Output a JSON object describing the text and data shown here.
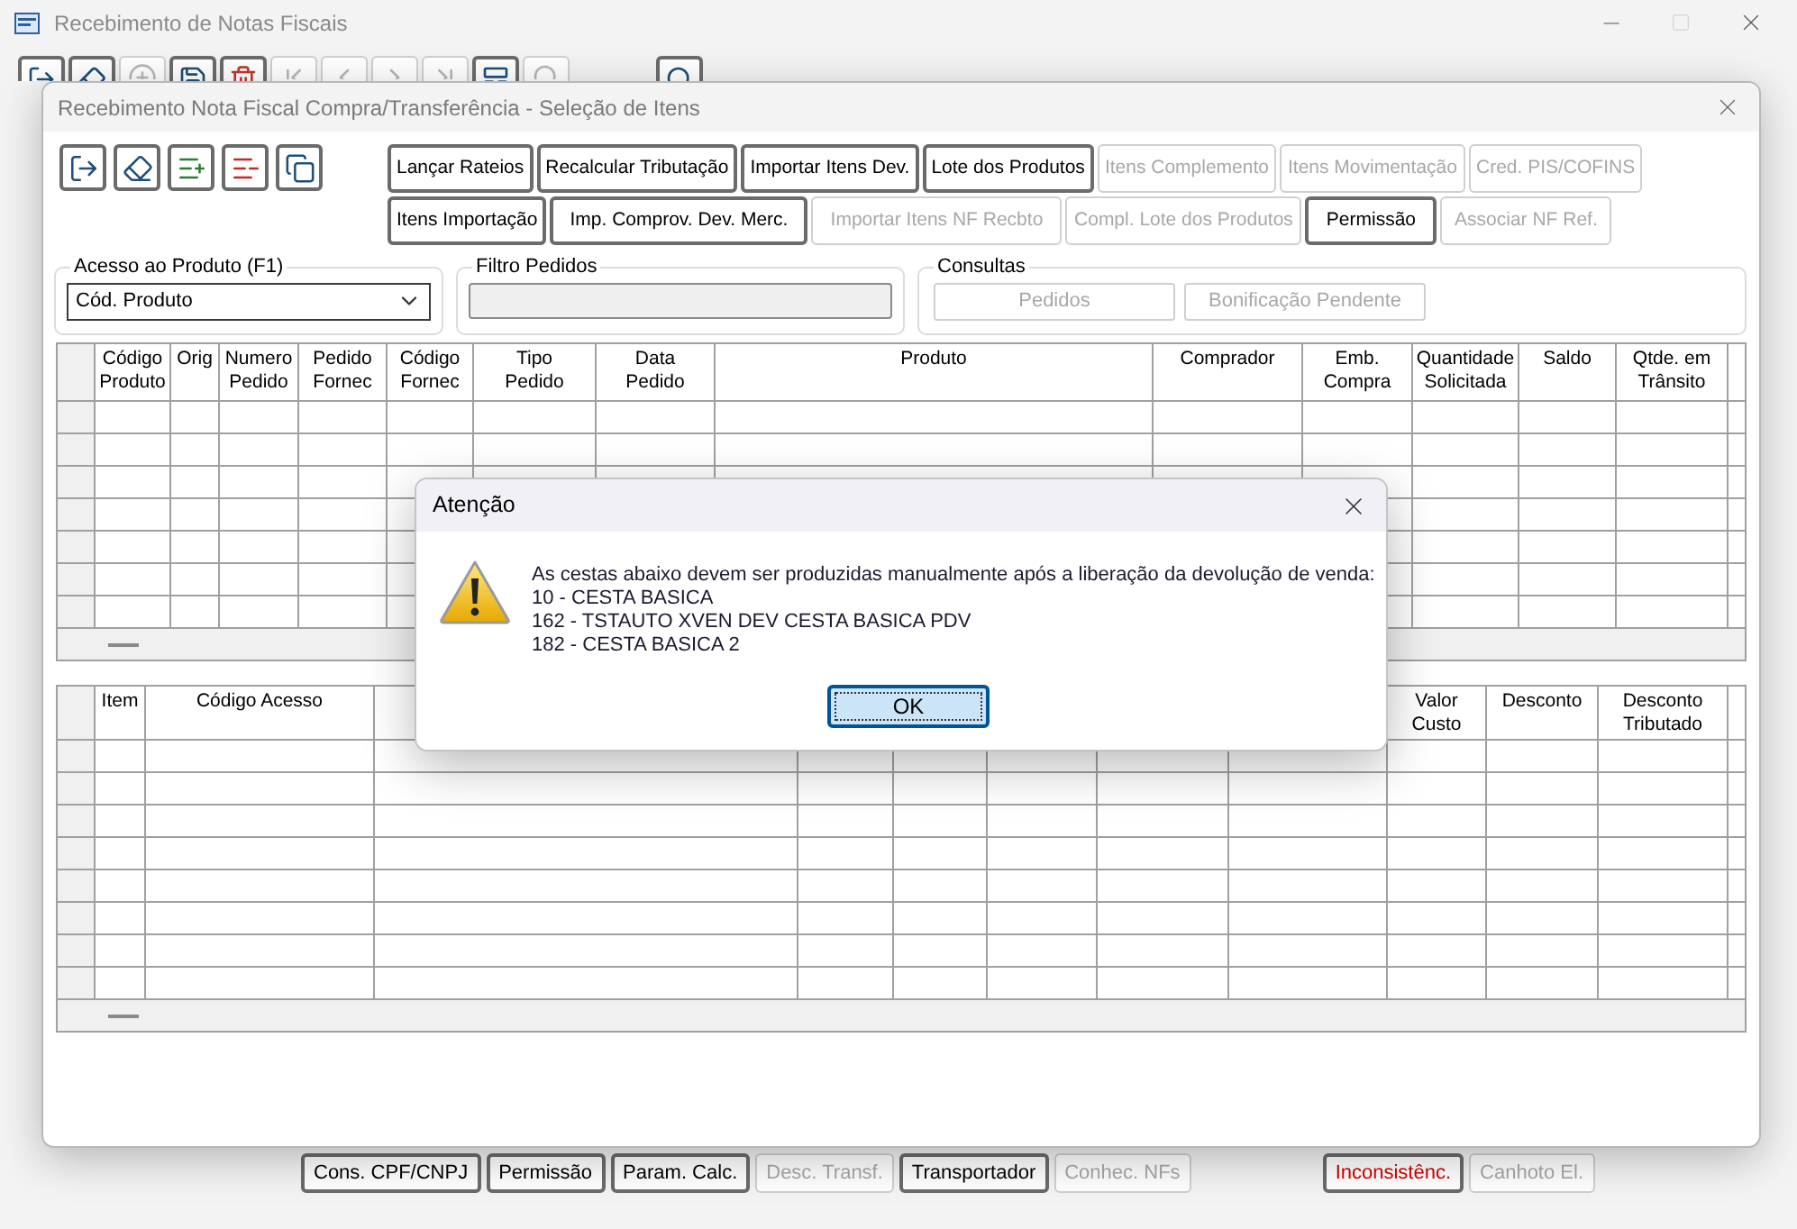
{
  "background_window": {
    "title": "Recebimento de Notas Fiscais",
    "toolbar": [
      {
        "kind": "exit",
        "disabled": false
      },
      {
        "kind": "eraser",
        "disabled": false
      },
      {
        "kind": "add",
        "disabled": true
      },
      {
        "kind": "save",
        "disabled": false
      },
      {
        "kind": "delete",
        "disabled": false
      },
      {
        "kind": "first",
        "disabled": true
      },
      {
        "kind": "previous",
        "disabled": true
      },
      {
        "kind": "next",
        "disabled": true
      },
      {
        "kind": "last",
        "disabled": true
      },
      {
        "kind": "grid",
        "disabled": false
      },
      {
        "kind": "search",
        "disabled": true
      },
      {
        "kind": "search",
        "disabled": false
      }
    ],
    "bottom_buttons": [
      {
        "label": "Cons. CPF/CNPJ",
        "disabled": false
      },
      {
        "label": "Permissão",
        "disabled": false
      },
      {
        "label": "Param. Calc.",
        "disabled": false
      },
      {
        "label": "Desc. Transf.",
        "disabled": true
      },
      {
        "label": "Transportador",
        "disabled": false
      },
      {
        "label": "Conhec. NFs",
        "disabled": true
      },
      {
        "label": "Inconsistênc.",
        "disabled": false,
        "color": "#d40000"
      },
      {
        "label": "Canhoto El.",
        "disabled": true
      }
    ]
  },
  "window": {
    "title": "Recebimento Nota Fiscal Compra/Transferência - Seleção de Itens",
    "icon_buttons": [
      {
        "kind": "exit"
      },
      {
        "kind": "eraser"
      },
      {
        "kind": "list-add"
      },
      {
        "kind": "list-remove"
      },
      {
        "kind": "copy"
      }
    ],
    "button_rows": [
      [
        {
          "label": "Lançar Rateios",
          "disabled": false
        },
        {
          "label": "Recalcular Tributação",
          "disabled": false
        },
        {
          "label": "Importar Itens Dev.",
          "disabled": false
        },
        {
          "label": "Lote dos Produtos",
          "disabled": false
        },
        {
          "label": "Itens Complemento",
          "disabled": true
        },
        {
          "label": "Itens Movimentação",
          "disabled": true
        },
        {
          "label": "Cred. PIS/COFINS",
          "disabled": true
        }
      ],
      [
        {
          "label": "Itens Importação",
          "disabled": false
        },
        {
          "label": "Imp. Comprov. Dev. Merc.",
          "disabled": false
        },
        {
          "label": "Importar Itens NF Recbto",
          "disabled": true
        },
        {
          "label": "Compl. Lote dos Produtos",
          "disabled": true
        },
        {
          "label": "Permissão",
          "disabled": false
        },
        {
          "label": "Associar NF Ref.",
          "disabled": true
        }
      ]
    ],
    "product_access": {
      "title": "Acesso ao Produto (F1)",
      "value": "Cód. Produto"
    },
    "order_filter": {
      "title": "Filtro Pedidos",
      "disabled": true
    },
    "queries": {
      "title": "Consultas",
      "buttons": [
        {
          "label": "Pedidos",
          "disabled": true
        },
        {
          "label": "Bonificação Pendente",
          "disabled": true
        }
      ]
    },
    "orders_table": {
      "columns": [
        {
          "label": "Código\nProduto"
        },
        {
          "label": "Orig"
        },
        {
          "label": "Numero\nPedido"
        },
        {
          "label": "Pedido\nFornec"
        },
        {
          "label": "Código\nFornec"
        },
        {
          "label": "Tipo\nPedido"
        },
        {
          "label": "Data\nPedido"
        },
        {
          "label": "Produto"
        },
        {
          "label": "Comprador"
        },
        {
          "label": "Emb.\nCompra"
        },
        {
          "label": "Quantidade\nSolicitada"
        },
        {
          "label": "Saldo"
        },
        {
          "label": "Qtde. em\nTrânsito"
        },
        {}
      ]
    },
    "items_table": {
      "columns": [
        {
          "label": "Item"
        },
        {
          "label": "Código Acesso"
        },
        {},
        {},
        {},
        {},
        {},
        {},
        {
          "label": "Valor\nCusto"
        },
        {
          "label": "Desconto"
        },
        {
          "label": "Desconto\nTributado"
        },
        {}
      ]
    }
  },
  "alert": {
    "title": "Atenção",
    "lines": [
      "As cestas abaixo devem ser produzidas manualmente após a liberação da devolução de venda:",
      "10 - CESTA BASICA",
      "162 - TSTAUTO XVEN DEV CESTA BASICA PDV",
      "182 - CESTA BASICA 2"
    ],
    "ok": "OK"
  }
}
